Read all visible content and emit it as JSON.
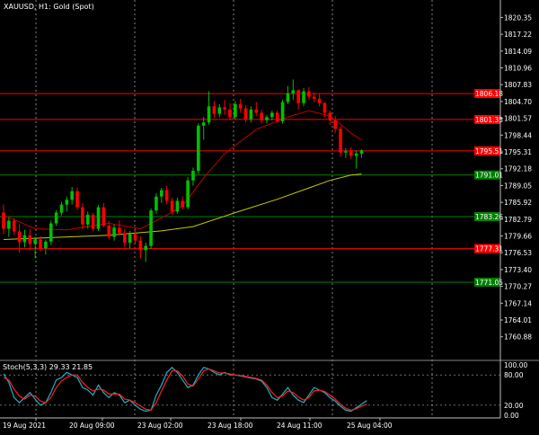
{
  "chart_data": {
    "type": "candlestick",
    "title": "XAUUSD, H1:  Gold (Spot)",
    "time_labels": [
      "19 Aug 2021",
      "20 Aug 09:00",
      "23 Aug 02:00",
      "23 Aug 18:00",
      "24 Aug 11:00",
      "25 Aug 04:00"
    ],
    "main_axis": {
      "ylim": [
        1756.65,
        1823.6
      ],
      "ticks": [
        "1820.35",
        "1817.22",
        "1814.09",
        "1810.96",
        "1807.83",
        "1804.70",
        "1801.57",
        "1798.44",
        "1795.31",
        "1792.18",
        "1789.05",
        "1785.92",
        "1782.79",
        "1779.66",
        "1776.53",
        "1773.40",
        "1770.27",
        "1767.14",
        "1764.01",
        "1760.88"
      ]
    },
    "levels": [
      {
        "value": "1806.18",
        "kind": "resistance",
        "color": "#ff0000"
      },
      {
        "value": "1801.35",
        "kind": "resistance",
        "color": "#ff0000"
      },
      {
        "value": "1795.51",
        "kind": "resistance",
        "color": "#ff0000"
      },
      {
        "value": "1791.01",
        "kind": "support",
        "color": "#008000"
      },
      {
        "value": "1783.26",
        "kind": "support",
        "color": "#008000"
      },
      {
        "value": "1777.31",
        "kind": "resistance",
        "color": "#ff0000"
      },
      {
        "value": "1771.05",
        "kind": "support",
        "color": "#008000"
      }
    ],
    "candles": [
      [
        1784.0,
        1785.5,
        1780.0,
        1781.0
      ],
      [
        1781.0,
        1783.0,
        1779.5,
        1782.5
      ],
      [
        1782.5,
        1783.0,
        1779.8,
        1780.5
      ],
      [
        1780.5,
        1782.0,
        1776.5,
        1778.5
      ],
      [
        1778.5,
        1780.8,
        1777.5,
        1779.8
      ],
      [
        1779.8,
        1781.0,
        1777.0,
        1778.2
      ],
      [
        1778.2,
        1779.5,
        1775.5,
        1779.0
      ],
      [
        1779.0,
        1779.6,
        1776.8,
        1777.4
      ],
      [
        1777.4,
        1779.0,
        1776.2,
        1778.6
      ],
      [
        1778.6,
        1782.5,
        1778.0,
        1782.0
      ],
      [
        1782.0,
        1784.5,
        1781.5,
        1784.0
      ],
      [
        1784.0,
        1786.0,
        1783.5,
        1785.5
      ],
      [
        1785.5,
        1787.0,
        1784.2,
        1786.4
      ],
      [
        1786.4,
        1788.8,
        1785.5,
        1788.0
      ],
      [
        1788.0,
        1788.6,
        1784.5,
        1785.0
      ],
      [
        1785.0,
        1785.8,
        1781.0,
        1781.8
      ],
      [
        1781.8,
        1784.2,
        1781.0,
        1783.6
      ],
      [
        1783.6,
        1784.0,
        1780.5,
        1781.0
      ],
      [
        1781.0,
        1785.4,
        1780.6,
        1785.0
      ],
      [
        1785.0,
        1785.8,
        1781.2,
        1781.6
      ],
      [
        1781.6,
        1782.5,
        1779.0,
        1779.5
      ],
      [
        1779.5,
        1781.8,
        1778.8,
        1781.2
      ],
      [
        1781.2,
        1782.6,
        1779.8,
        1780.2
      ],
      [
        1780.2,
        1781.0,
        1777.6,
        1778.4
      ],
      [
        1778.4,
        1780.6,
        1777.4,
        1780.0
      ],
      [
        1780.0,
        1781.2,
        1778.2,
        1778.8
      ],
      [
        1778.8,
        1779.6,
        1775.5,
        1777.0
      ],
      [
        1777.0,
        1778.4,
        1774.8,
        1777.8
      ],
      [
        1777.8,
        1784.8,
        1777.2,
        1784.4
      ],
      [
        1784.4,
        1787.6,
        1783.8,
        1787.0
      ],
      [
        1787.0,
        1788.6,
        1785.8,
        1788.2
      ],
      [
        1788.2,
        1789.0,
        1785.6,
        1786.2
      ],
      [
        1786.2,
        1786.8,
        1783.6,
        1784.2
      ],
      [
        1784.2,
        1786.8,
        1783.8,
        1786.2
      ],
      [
        1786.2,
        1787.0,
        1784.6,
        1785.0
      ],
      [
        1785.0,
        1790.6,
        1784.6,
        1790.0
      ],
      [
        1790.0,
        1792.4,
        1789.0,
        1791.8
      ],
      [
        1791.8,
        1800.6,
        1791.2,
        1800.2
      ],
      [
        1800.2,
        1801.8,
        1797.6,
        1800.8
      ],
      [
        1800.8,
        1806.6,
        1800.4,
        1803.8
      ],
      [
        1803.8,
        1804.8,
        1801.6,
        1802.4
      ],
      [
        1802.4,
        1804.2,
        1801.8,
        1803.6
      ],
      [
        1803.6,
        1805.0,
        1802.2,
        1803.2
      ],
      [
        1803.2,
        1804.4,
        1801.2,
        1801.8
      ],
      [
        1801.8,
        1804.8,
        1801.4,
        1804.2
      ],
      [
        1804.2,
        1805.2,
        1802.6,
        1803.4
      ],
      [
        1803.4,
        1804.0,
        1800.8,
        1801.4
      ],
      [
        1801.4,
        1803.8,
        1800.8,
        1803.2
      ],
      [
        1803.2,
        1804.6,
        1802.0,
        1802.6
      ],
      [
        1802.6,
        1803.2,
        1800.6,
        1801.2
      ],
      [
        1801.2,
        1802.2,
        1800.6,
        1801.8
      ],
      [
        1801.8,
        1803.0,
        1801.2,
        1802.6
      ],
      [
        1802.6,
        1803.0,
        1800.6,
        1801.0
      ],
      [
        1801.0,
        1805.0,
        1800.6,
        1804.6
      ],
      [
        1804.6,
        1807.6,
        1804.2,
        1806.2
      ],
      [
        1806.2,
        1808.8,
        1805.0,
        1806.8
      ],
      [
        1806.8,
        1807.0,
        1803.2,
        1804.4
      ],
      [
        1804.4,
        1807.2,
        1803.8,
        1806.6
      ],
      [
        1806.6,
        1807.4,
        1805.0,
        1805.6
      ],
      [
        1805.6,
        1806.4,
        1804.6,
        1805.2
      ],
      [
        1805.2,
        1806.2,
        1803.8,
        1804.4
      ],
      [
        1804.4,
        1804.6,
        1801.8,
        1802.6
      ],
      [
        1802.6,
        1803.0,
        1800.4,
        1801.2
      ],
      [
        1801.2,
        1802.0,
        1798.8,
        1799.6
      ],
      [
        1799.6,
        1800.2,
        1794.4,
        1795.2
      ],
      [
        1795.2,
        1796.0,
        1794.2,
        1795.4
      ],
      [
        1795.4,
        1796.2,
        1794.0,
        1794.6
      ],
      [
        1794.6,
        1795.6,
        1792.2,
        1795.0
      ],
      [
        1795.0,
        1795.8,
        1794.2,
        1795.6
      ]
    ],
    "moving_averages": [
      {
        "color": "#c00000",
        "points": [
          [
            0,
            1783.5
          ],
          [
            6,
            1781.0
          ],
          [
            12,
            1780.8
          ],
          [
            20,
            1782.0
          ],
          [
            26,
            1781.0
          ],
          [
            30,
            1783.0
          ],
          [
            34,
            1785.2
          ],
          [
            38,
            1790.5
          ],
          [
            42,
            1795.0
          ],
          [
            48,
            1799.5
          ],
          [
            54,
            1801.8
          ],
          [
            58,
            1803.0
          ],
          [
            62,
            1802.0
          ],
          [
            64,
            1800.5
          ],
          [
            66,
            1798.8
          ],
          [
            68,
            1797.5
          ]
        ]
      },
      {
        "color": "#c8c800",
        "points": [
          [
            0,
            1779.0
          ],
          [
            10,
            1779.4
          ],
          [
            20,
            1779.8
          ],
          [
            30,
            1780.6
          ],
          [
            36,
            1781.4
          ],
          [
            44,
            1784.0
          ],
          [
            52,
            1786.5
          ],
          [
            58,
            1788.6
          ],
          [
            62,
            1790.0
          ],
          [
            66,
            1791.0
          ],
          [
            68,
            1791.2
          ]
        ]
      }
    ],
    "stochastic": {
      "label": "Stoch(5,3,3) 29.33 21.85",
      "ylim": [
        0,
        100
      ],
      "ticks": [
        "100.00",
        "80.00",
        "20.00",
        "0.00"
      ],
      "main": [
        82,
        65,
        35,
        25,
        35,
        45,
        32,
        20,
        25,
        45,
        70,
        75,
        85,
        80,
        75,
        55,
        50,
        40,
        60,
        45,
        35,
        45,
        40,
        25,
        30,
        20,
        12,
        8,
        10,
        40,
        60,
        85,
        95,
        85,
        70,
        55,
        60,
        80,
        95,
        92,
        85,
        80,
        85,
        80,
        80,
        78,
        76,
        74,
        72,
        68,
        55,
        35,
        30,
        42,
        55,
        40,
        30,
        25,
        40,
        55,
        50,
        45,
        35,
        28,
        18,
        10,
        8,
        15,
        22,
        29
      ],
      "signal": [
        75,
        70,
        52,
        38,
        32,
        40,
        38,
        28,
        25,
        35,
        55,
        68,
        75,
        80,
        80,
        65,
        55,
        48,
        52,
        50,
        42,
        42,
        42,
        32,
        30,
        25,
        18,
        12,
        10,
        25,
        48,
        70,
        88,
        88,
        78,
        62,
        58,
        72,
        88,
        92,
        88,
        84,
        84,
        82,
        80,
        79,
        77,
        75,
        73,
        70,
        60,
        45,
        35,
        38,
        48,
        45,
        36,
        30,
        35,
        48,
        50,
        47,
        40,
        32,
        22,
        14,
        10,
        13,
        18,
        22
      ]
    }
  }
}
